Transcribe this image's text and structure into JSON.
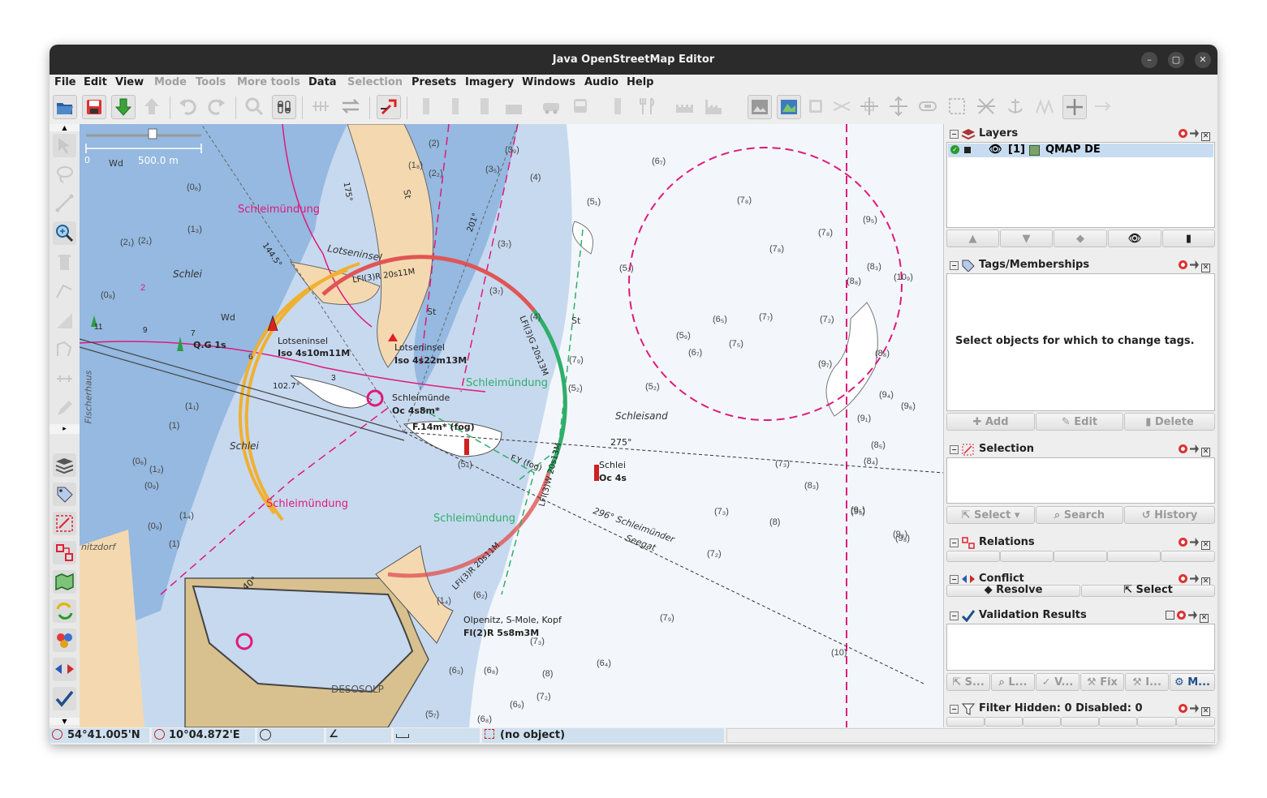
{
  "window": {
    "title": "Java OpenStreetMap Editor"
  },
  "menubar": {
    "items": [
      {
        "label": "File",
        "enabled": true
      },
      {
        "label": "Edit",
        "enabled": true
      },
      {
        "label": "View",
        "enabled": true
      },
      {
        "label": "Mode",
        "enabled": false
      },
      {
        "label": "Tools",
        "enabled": false
      },
      {
        "label": "More tools",
        "enabled": false
      },
      {
        "label": "Data",
        "enabled": true
      },
      {
        "label": "Selection",
        "enabled": false
      },
      {
        "label": "Presets",
        "enabled": true
      },
      {
        "label": "Imagery",
        "enabled": true
      },
      {
        "label": "Windows",
        "enabled": true
      },
      {
        "label": "Audio",
        "enabled": true
      },
      {
        "label": "Help",
        "enabled": true
      }
    ]
  },
  "map": {
    "scale_label": "500.0 m",
    "scale_zero": "0",
    "labels": {
      "schleimundung_1": "Schleimündung",
      "schleimundung_2": "Schleimündung",
      "schleimundung_3": "Schleimündung",
      "schleimundung_4": "Schleimündung",
      "lotseninsel": "Lotseninsel",
      "schlei_1": "Schlei",
      "schlei_2": "Schlei",
      "schleisand": "Schleisand",
      "fischerhaus": "Fischerhaus",
      "nitzdorf": "nitzdorf",
      "light_1_name": "Lotseninsel",
      "light_1_char": "Iso 4s10m11M",
      "light_2_name": "Lotseninsel",
      "light_2_char": "Iso 4s22m13M",
      "light_3_name": "Schleimünde",
      "light_3_char": "Oc 4s8m*",
      "light_4": "F.14m* (fog)",
      "light_5": "Q.G 1s",
      "light_6_name": "Schlei",
      "light_6_char": "Oc 4s",
      "light_7_name": "Olpenitz, S-Mole, Kopf",
      "light_7_char": "Fl(2)R 5s8m3M",
      "sector_1": "LFl(3)R 20s11M",
      "sector_2": "LFl(3)G 20s13M",
      "sector_3": "LFl(3)W 20s13M",
      "sector_4": "LFl(3)R 20s11M",
      "fog": "F.Y (fog)",
      "bearing_1": "275°",
      "bearing_2": "296° Schleimünder",
      "seegat": "Seegat",
      "bearing_3": "102.7°",
      "bearing_4": "144.5°",
      "bearing_5": "201°",
      "bearing_6": "175°",
      "bearing_7": "40°",
      "deso": "DESOSOLP",
      "st_1": "St",
      "st_2": "St",
      "st_3": "St",
      "wd_1": "Wd",
      "wd_2": "Wd",
      "depths": [
        "(2)",
        "(1₈)",
        "(2₂)",
        "(3₅)",
        "(3₉)",
        "(4)",
        "(6₇)",
        "(0₆)",
        "(2₁)",
        "(2₁)",
        "(1₃)",
        "(0₈)",
        "(3₇)",
        "(3₇)",
        "(4)",
        "(5₁)",
        "(5₂)",
        "(7₈)",
        "(7₈)",
        "(7₈)",
        "(9₅)",
        "(8₃)",
        "(8₈)",
        "(10₉)",
        "(6₅)",
        "(7₇)",
        "(7₂)",
        "(5₉)",
        "(6₇)",
        "(7₅)",
        "(9₇)",
        "(8₈)",
        "(7₉)",
        "(5₂)",
        "(5₂)",
        "(1₁)",
        "(1)",
        "(1₂)",
        "(0₆)",
        "(0₉)",
        "(1₄)",
        "(0₉)",
        "(1)",
        "(5₄)",
        "(7₃)",
        "(8₃)",
        "(7₃)",
        "(8)",
        "(7₂)",
        "(7₉)",
        "(9₅)",
        "(9₈)",
        "(1₄)",
        "(6₂)",
        "(7₃)",
        "(6₃)",
        "(6₈)",
        "(8)",
        "(7₂)",
        "(6₄)",
        "(6₉)",
        "(5₇)",
        "(6₈)",
        "(10)",
        "(9₄)",
        "(9₆)",
        "(9₁)",
        "(8₅)",
        "(8₄)",
        "(9₅)",
        "(9₈)"
      ],
      "contours": [
        "10",
        "10",
        "10",
        "10",
        "10",
        "10",
        "5",
        "5",
        "2",
        "2",
        "11",
        "9",
        "7",
        "6",
        "3",
        "2"
      ]
    }
  },
  "layers": {
    "title": "Layers",
    "items": [
      {
        "index": "[1]",
        "name": "QMAP DE",
        "visible": true,
        "active": true
      }
    ]
  },
  "tags": {
    "title": "Tags/Memberships",
    "empty_text": "Select objects for which to change tags.",
    "buttons": {
      "add": "Add",
      "edit": "Edit",
      "delete": "Delete"
    }
  },
  "selection": {
    "title": "Selection",
    "buttons": {
      "select": "Select",
      "search": "Search",
      "history": "History"
    }
  },
  "relations": {
    "title": "Relations"
  },
  "conflict": {
    "title": "Conflict",
    "buttons": {
      "resolve": "Resolve",
      "select": "Select"
    }
  },
  "validation": {
    "title": "Validation Results",
    "buttons": [
      "S...",
      "L...",
      "V...",
      "Fix",
      "I...",
      "M..."
    ]
  },
  "filter": {
    "title": "Filter Hidden: 0 Disabled: 0"
  },
  "status": {
    "lat": "54°41.005'N",
    "lon": "10°04.872'E",
    "object": "(no object)"
  },
  "colors": {
    "land": "#f4d9b0",
    "shallow": "#95b9e0",
    "mid": "#c7d9ef",
    "deep": "#f3f7fb",
    "boundary": "#e0197d",
    "sector_red": "#e05555",
    "sector_green": "#2fae6a",
    "sector_yellow": "#f0b030",
    "selection_row": "#c7dcf0"
  }
}
